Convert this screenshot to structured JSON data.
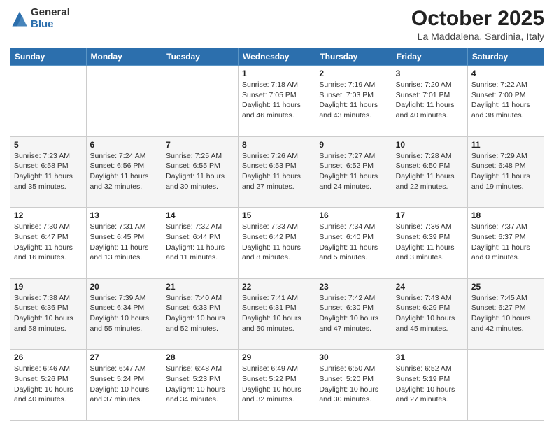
{
  "header": {
    "logo_general": "General",
    "logo_blue": "Blue",
    "month": "October 2025",
    "location": "La Maddalena, Sardinia, Italy"
  },
  "days_of_week": [
    "Sunday",
    "Monday",
    "Tuesday",
    "Wednesday",
    "Thursday",
    "Friday",
    "Saturday"
  ],
  "weeks": [
    [
      {
        "day": "",
        "info": ""
      },
      {
        "day": "",
        "info": ""
      },
      {
        "day": "",
        "info": ""
      },
      {
        "day": "1",
        "info": "Sunrise: 7:18 AM\nSunset: 7:05 PM\nDaylight: 11 hours and 46 minutes."
      },
      {
        "day": "2",
        "info": "Sunrise: 7:19 AM\nSunset: 7:03 PM\nDaylight: 11 hours and 43 minutes."
      },
      {
        "day": "3",
        "info": "Sunrise: 7:20 AM\nSunset: 7:01 PM\nDaylight: 11 hours and 40 minutes."
      },
      {
        "day": "4",
        "info": "Sunrise: 7:22 AM\nSunset: 7:00 PM\nDaylight: 11 hours and 38 minutes."
      }
    ],
    [
      {
        "day": "5",
        "info": "Sunrise: 7:23 AM\nSunset: 6:58 PM\nDaylight: 11 hours and 35 minutes."
      },
      {
        "day": "6",
        "info": "Sunrise: 7:24 AM\nSunset: 6:56 PM\nDaylight: 11 hours and 32 minutes."
      },
      {
        "day": "7",
        "info": "Sunrise: 7:25 AM\nSunset: 6:55 PM\nDaylight: 11 hours and 30 minutes."
      },
      {
        "day": "8",
        "info": "Sunrise: 7:26 AM\nSunset: 6:53 PM\nDaylight: 11 hours and 27 minutes."
      },
      {
        "day": "9",
        "info": "Sunrise: 7:27 AM\nSunset: 6:52 PM\nDaylight: 11 hours and 24 minutes."
      },
      {
        "day": "10",
        "info": "Sunrise: 7:28 AM\nSunset: 6:50 PM\nDaylight: 11 hours and 22 minutes."
      },
      {
        "day": "11",
        "info": "Sunrise: 7:29 AM\nSunset: 6:48 PM\nDaylight: 11 hours and 19 minutes."
      }
    ],
    [
      {
        "day": "12",
        "info": "Sunrise: 7:30 AM\nSunset: 6:47 PM\nDaylight: 11 hours and 16 minutes."
      },
      {
        "day": "13",
        "info": "Sunrise: 7:31 AM\nSunset: 6:45 PM\nDaylight: 11 hours and 13 minutes."
      },
      {
        "day": "14",
        "info": "Sunrise: 7:32 AM\nSunset: 6:44 PM\nDaylight: 11 hours and 11 minutes."
      },
      {
        "day": "15",
        "info": "Sunrise: 7:33 AM\nSunset: 6:42 PM\nDaylight: 11 hours and 8 minutes."
      },
      {
        "day": "16",
        "info": "Sunrise: 7:34 AM\nSunset: 6:40 PM\nDaylight: 11 hours and 5 minutes."
      },
      {
        "day": "17",
        "info": "Sunrise: 7:36 AM\nSunset: 6:39 PM\nDaylight: 11 hours and 3 minutes."
      },
      {
        "day": "18",
        "info": "Sunrise: 7:37 AM\nSunset: 6:37 PM\nDaylight: 11 hours and 0 minutes."
      }
    ],
    [
      {
        "day": "19",
        "info": "Sunrise: 7:38 AM\nSunset: 6:36 PM\nDaylight: 10 hours and 58 minutes."
      },
      {
        "day": "20",
        "info": "Sunrise: 7:39 AM\nSunset: 6:34 PM\nDaylight: 10 hours and 55 minutes."
      },
      {
        "day": "21",
        "info": "Sunrise: 7:40 AM\nSunset: 6:33 PM\nDaylight: 10 hours and 52 minutes."
      },
      {
        "day": "22",
        "info": "Sunrise: 7:41 AM\nSunset: 6:31 PM\nDaylight: 10 hours and 50 minutes."
      },
      {
        "day": "23",
        "info": "Sunrise: 7:42 AM\nSunset: 6:30 PM\nDaylight: 10 hours and 47 minutes."
      },
      {
        "day": "24",
        "info": "Sunrise: 7:43 AM\nSunset: 6:29 PM\nDaylight: 10 hours and 45 minutes."
      },
      {
        "day": "25",
        "info": "Sunrise: 7:45 AM\nSunset: 6:27 PM\nDaylight: 10 hours and 42 minutes."
      }
    ],
    [
      {
        "day": "26",
        "info": "Sunrise: 6:46 AM\nSunset: 5:26 PM\nDaylight: 10 hours and 40 minutes."
      },
      {
        "day": "27",
        "info": "Sunrise: 6:47 AM\nSunset: 5:24 PM\nDaylight: 10 hours and 37 minutes."
      },
      {
        "day": "28",
        "info": "Sunrise: 6:48 AM\nSunset: 5:23 PM\nDaylight: 10 hours and 34 minutes."
      },
      {
        "day": "29",
        "info": "Sunrise: 6:49 AM\nSunset: 5:22 PM\nDaylight: 10 hours and 32 minutes."
      },
      {
        "day": "30",
        "info": "Sunrise: 6:50 AM\nSunset: 5:20 PM\nDaylight: 10 hours and 30 minutes."
      },
      {
        "day": "31",
        "info": "Sunrise: 6:52 AM\nSunset: 5:19 PM\nDaylight: 10 hours and 27 minutes."
      },
      {
        "day": "",
        "info": ""
      }
    ]
  ]
}
